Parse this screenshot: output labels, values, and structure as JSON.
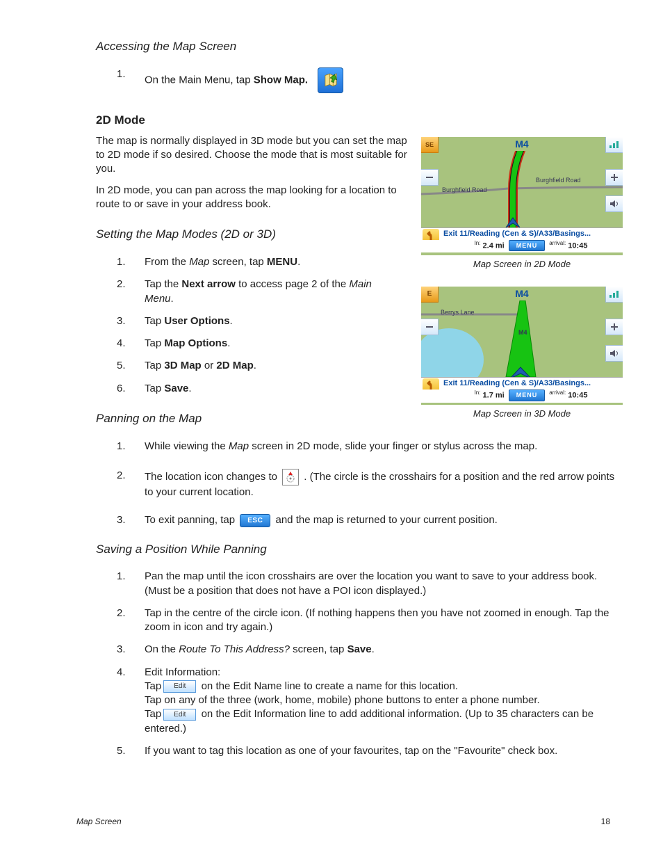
{
  "titles": {
    "accessing": "Accessing the Map Screen",
    "mode2d": "2D Mode",
    "setting": "Setting the Map Modes (2D or 3D)",
    "panning": "Panning on the Map",
    "saving": "Saving a Position While Panning"
  },
  "accessing_step": {
    "pre": "On the Main Menu, tap ",
    "bold": "Show Map."
  },
  "mode2d_paras": [
    "The map is normally displayed in 3D mode but you can set the map to 2D mode if so desired. Choose the mode that is most suitable for you.",
    "In 2D mode, you can pan across the map looking for a location to route to or save in your address book."
  ],
  "setting_steps": {
    "s1_pre": "From the ",
    "s1_ital": "Map",
    "s1_mid": " screen, tap ",
    "s1_bold": "MENU",
    "s1_end": ".",
    "s2_pre": "Tap the ",
    "s2_bold": "Next arrow",
    "s2_mid": " to access page 2 of the ",
    "s2_ital": "Main Menu",
    "s2_end": ".",
    "s3_pre": "Tap ",
    "s3_bold": "User Options",
    "s3_end": ".",
    "s4_pre": "Tap ",
    "s4_bold": "Map Options",
    "s4_end": ".",
    "s5_pre": "Tap ",
    "s5_b1": "3D Map",
    "s5_mid": " or ",
    "s5_b2": "2D Map",
    "s5_end": ".",
    "s6_pre": "Tap ",
    "s6_bold": "Save",
    "s6_end": "."
  },
  "panning_steps": {
    "p1_pre": "While viewing the ",
    "p1_ital": "Map",
    "p1_end": " screen in 2D mode, slide your finger or stylus across the map.",
    "p2_pre": " The location icon changes to ",
    "p2_post": ". (The circle is the crosshairs for a position and the red arrow points to your current location.",
    "p3_pre": "To exit panning, tap ",
    "p3_post": " and the map is returned to your current position."
  },
  "saving_steps": {
    "v1": "Pan the map until the icon crosshairs are over the location you want to save to your address book. (Must be a position that does not have a POI icon displayed.)",
    "v2": "Tap in the centre of the circle icon. (If nothing happens then you have not zoomed in enough. Tap the zoom in icon and try again.)",
    "v3_pre": "On the ",
    "v3_ital": "Route To This Address?",
    "v3_mid": " screen, tap ",
    "v3_bold": "Save",
    "v3_end": ".",
    "v4_title": "Edit Information:",
    "v4_a_pre": "Tap",
    "v4_a_post": " on the Edit Name line to create a name for this location.",
    "v4_b": "Tap on any of the three (work, home, mobile) phone buttons to enter a phone number.",
    "v4_c_pre": "Tap",
    "v4_c_post": " on the Edit Information line to add additional information. (Up to 35 characters can be entered.)",
    "v5": "If you want to tag this location as one of your favourites, tap on the \"Favourite\" check box."
  },
  "buttons": {
    "esc": "ESC",
    "edit": "Edit",
    "menu": "MENU"
  },
  "maps": {
    "road_main": "M4",
    "compass_se": "SE",
    "compass_e": "E",
    "lbl_burghfield": "Burghfield Road",
    "lbl_berrys": "Berrys Lane",
    "lbl_m4": "M4",
    "dest": "Exit 11/Reading (Cen & S)/A33/Basings...",
    "dist_2d": "2.4 mi",
    "dist_3d": "1.7 mi",
    "arrival": "10:45",
    "in_label": "In:",
    "arrival_label": "arrival:",
    "caption_2d": "Map Screen in 2D Mode",
    "caption_3d": "Map Screen in 3D Mode"
  },
  "footer": {
    "title": "Map Screen",
    "page": "18"
  }
}
